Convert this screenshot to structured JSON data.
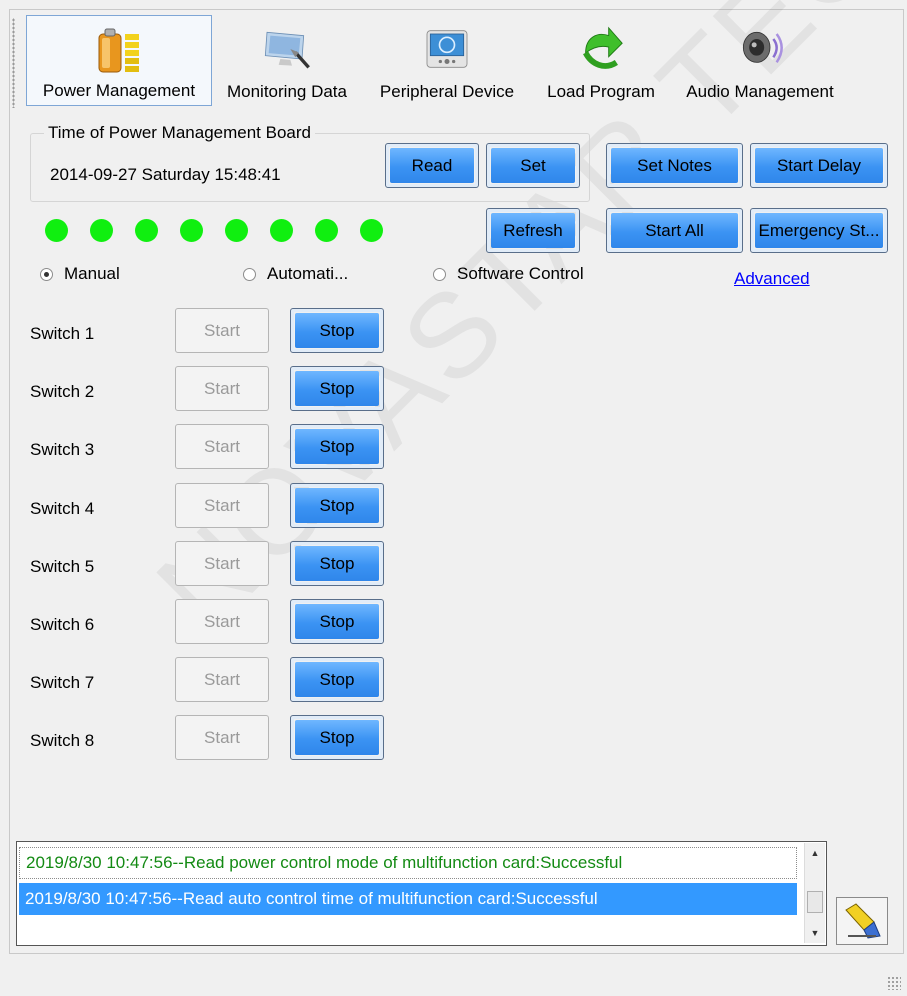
{
  "toolbar": {
    "items": [
      {
        "label": "Power Management",
        "icon": "battery-icon"
      },
      {
        "label": "Monitoring Data",
        "icon": "monitor-icon"
      },
      {
        "label": "Peripheral Device",
        "icon": "device-icon"
      },
      {
        "label": "Load Program",
        "icon": "load-arrow-icon"
      },
      {
        "label": "Audio Management",
        "icon": "speaker-icon"
      }
    ]
  },
  "board": {
    "group_title": "Time of Power Management Board",
    "time": "2014-09-27 Saturday 15:48:41",
    "read_label": "Read",
    "set_label": "Set"
  },
  "actions": {
    "set_notes": "Set Notes",
    "start_delay": "Start Delay",
    "refresh": "Refresh",
    "start_all": "Start All",
    "emergency_stop": "Emergency St...",
    "advanced": "Advanced"
  },
  "status_leds": {
    "count": 8,
    "color": "#10ef10"
  },
  "mode": {
    "options": [
      "Manual",
      "Automati...",
      "Software Control"
    ],
    "selected": "Manual"
  },
  "switches": [
    {
      "label": "Switch 1",
      "start": "Start",
      "stop": "Stop"
    },
    {
      "label": "Switch 2",
      "start": "Start",
      "stop": "Stop"
    },
    {
      "label": "Switch 3",
      "start": "Start",
      "stop": "Stop"
    },
    {
      "label": "Switch 4",
      "start": "Start",
      "stop": "Stop"
    },
    {
      "label": "Switch 5",
      "start": "Start",
      "stop": "Stop"
    },
    {
      "label": "Switch 6",
      "start": "Start",
      "stop": "Stop"
    },
    {
      "label": "Switch 7",
      "start": "Start",
      "stop": "Stop"
    },
    {
      "label": "Switch 8",
      "start": "Start",
      "stop": "Stop"
    }
  ],
  "log": [
    "2019/8/30 10:47:56--Read power control mode of multifunction card:Successful",
    "2019/8/30 10:47:56--Read auto control time of multifunction card:Successful"
  ],
  "watermark": "NOVASTAR TECH CO., LTD",
  "colors": {
    "button_blue": "#3b93f3",
    "log_success": "#138a13",
    "selection": "#3399ff",
    "link": "#0000ff"
  }
}
